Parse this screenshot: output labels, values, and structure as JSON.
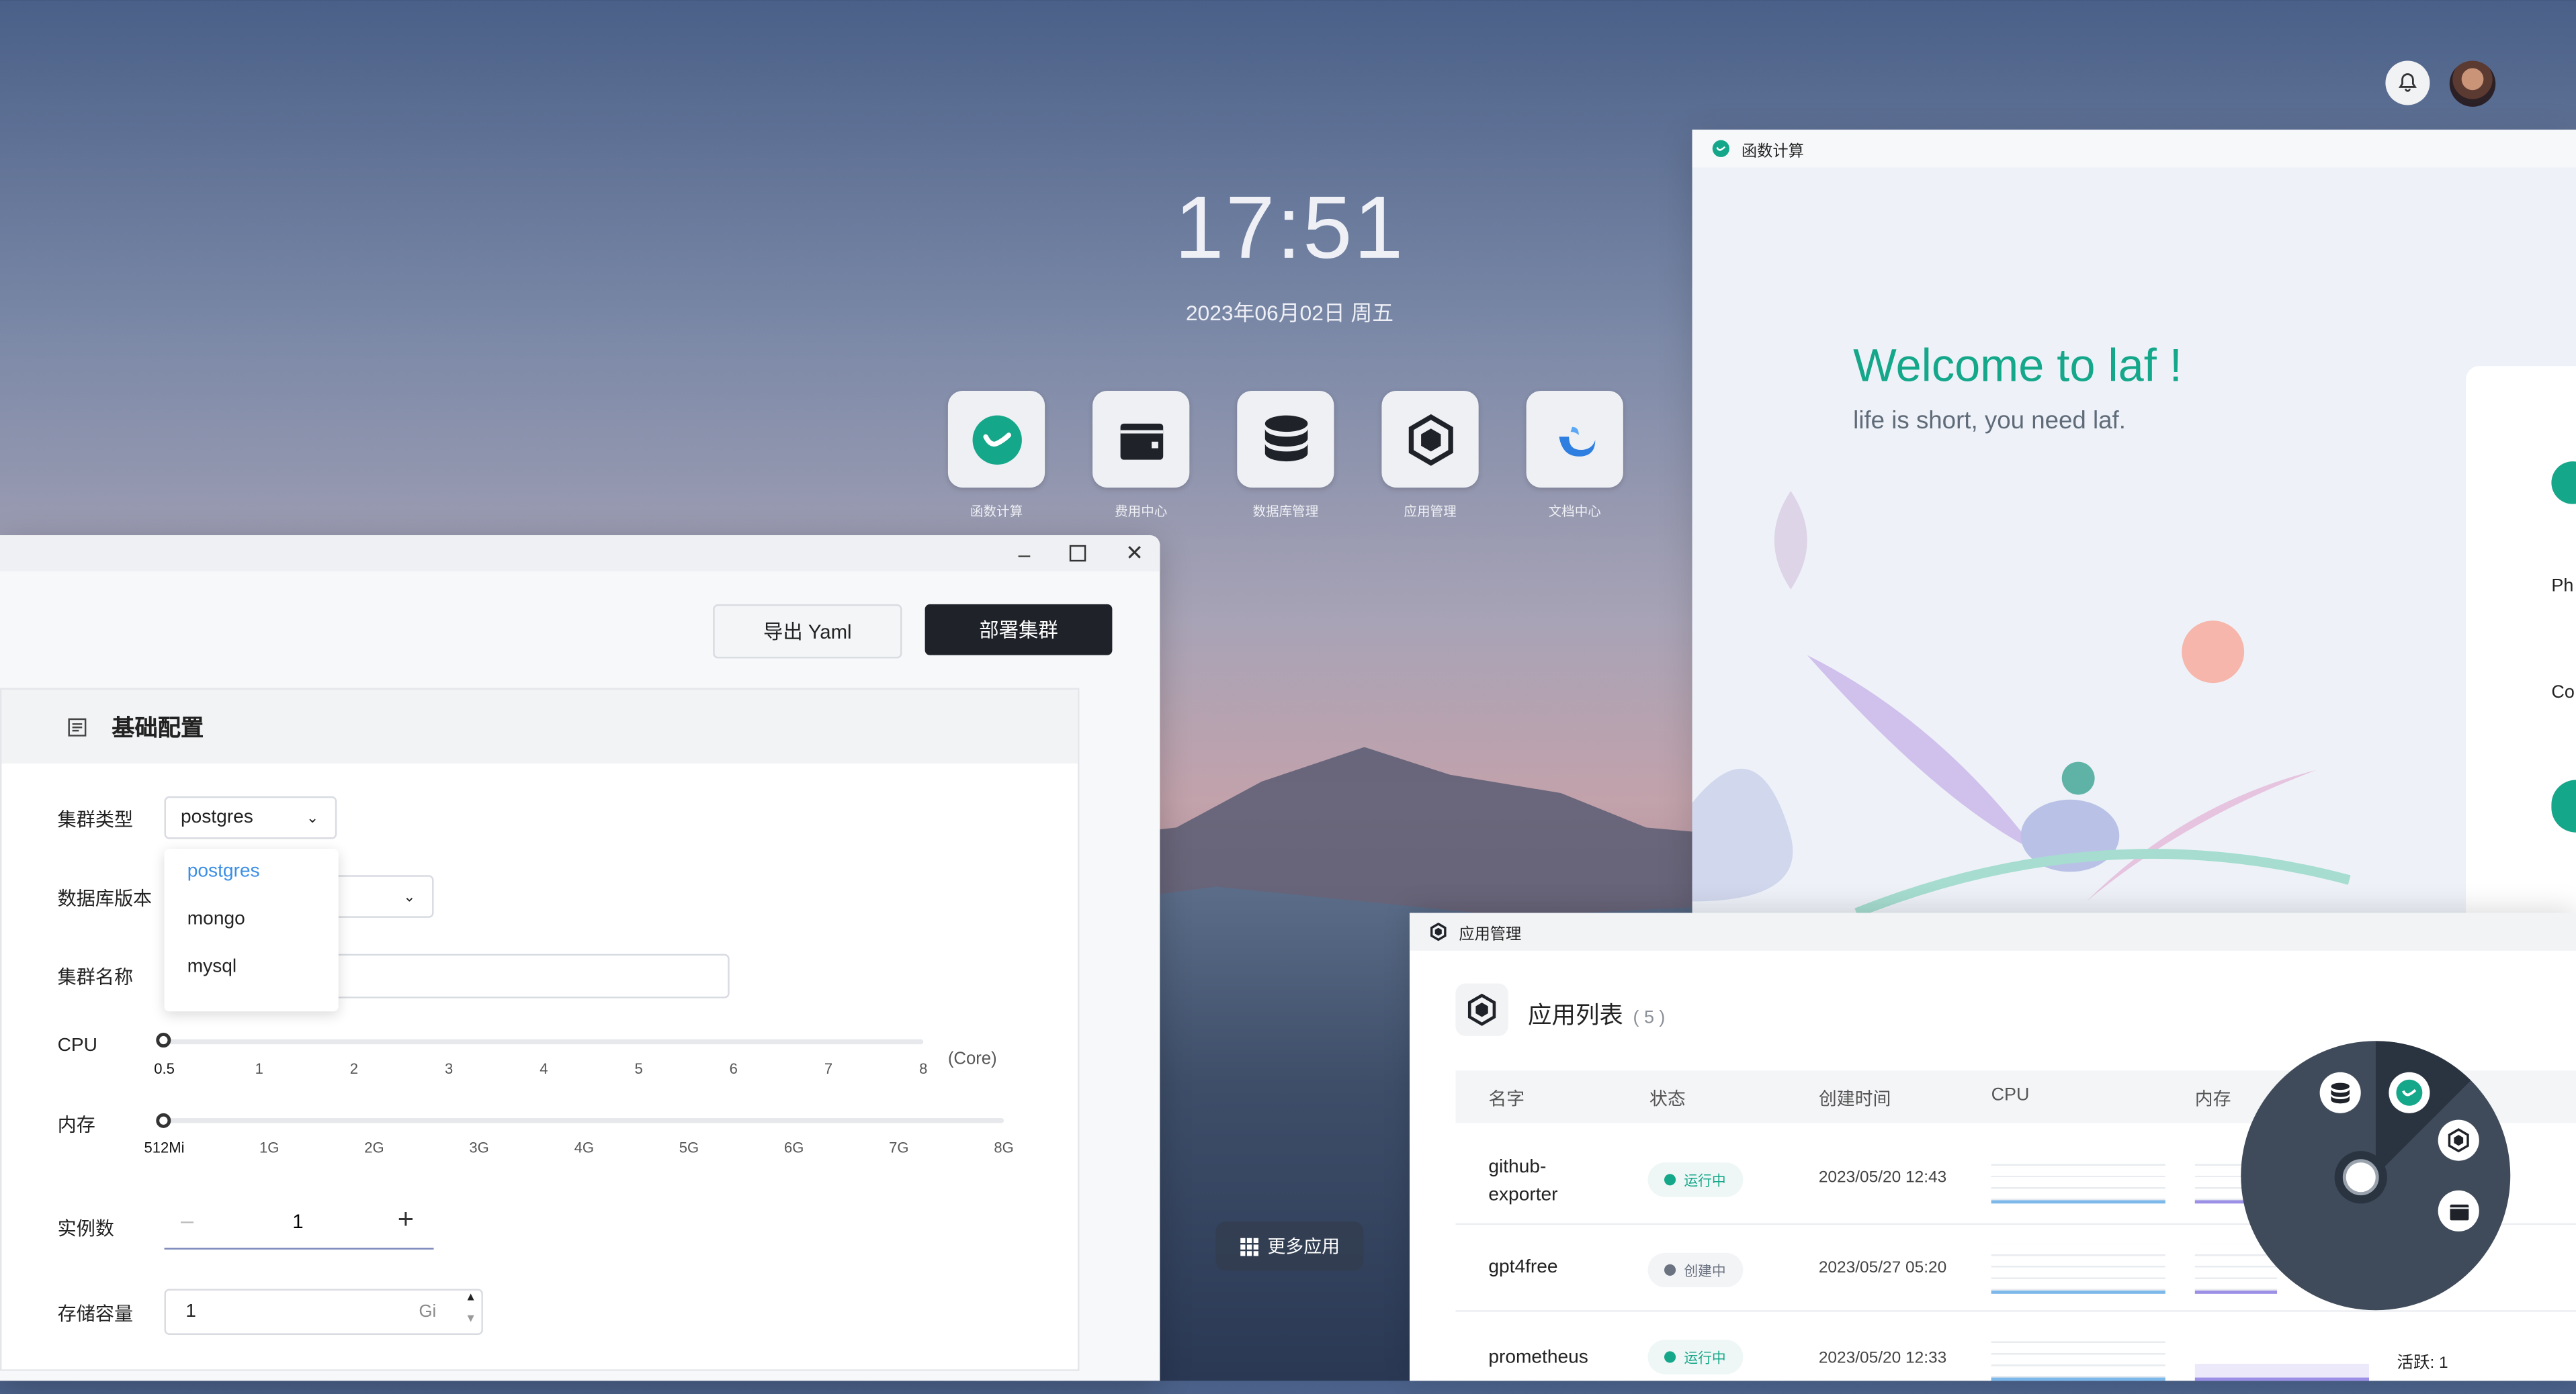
{
  "clock": {
    "time": "17:51",
    "date": "2023年06月02日 周五"
  },
  "dock": [
    {
      "label": "函数计算",
      "icon": "laf-icon"
    },
    {
      "label": "费用中心",
      "icon": "wallet-icon"
    },
    {
      "label": "数据库管理",
      "icon": "database-icon"
    },
    {
      "label": "应用管理",
      "icon": "app-hexagon-icon"
    },
    {
      "label": "文档中心",
      "icon": "docs-icon"
    }
  ],
  "db_window": {
    "export_label": "导出 Yaml",
    "deploy_label": "部署集群",
    "section_title": "基础配置",
    "fields": {
      "cluster_type_label": "集群类型",
      "cluster_type_value": "postgres",
      "db_version_label": "数据库版本",
      "cluster_name_label": "集群名称",
      "cpu_label": "CPU",
      "cpu_unit": "(Core)",
      "memory_label": "内存",
      "replicas_label": "实例数",
      "replicas_value": "1",
      "storage_label": "存储容量",
      "storage_value": "1",
      "storage_unit": "Gi"
    },
    "dropdown_options": [
      "postgres",
      "mongo",
      "mysql"
    ],
    "dropdown_selected": "postgres",
    "cpu_ticks": [
      "0.5",
      "1",
      "2",
      "3",
      "4",
      "5",
      "6",
      "7",
      "8"
    ],
    "cpu_value": "0.5",
    "memory_ticks": [
      "512Mi",
      "1G",
      "2G",
      "3G",
      "4G",
      "5G",
      "6G",
      "7G",
      "8G"
    ],
    "memory_value": "512Mi"
  },
  "laf_window": {
    "title": "函数计算",
    "welcome": "Welcome to laf !",
    "tagline": "life is short, you need laf.",
    "card_cut_1": "Ph",
    "card_cut_2": "Co"
  },
  "app_window": {
    "title": "应用管理",
    "list_title": "应用列表",
    "count": "( 5 )",
    "columns": [
      "名字",
      "状态",
      "创建时间",
      "CPU",
      "内存"
    ],
    "rows": [
      {
        "name_line1": "github-",
        "name_line2": "exporter",
        "status": "运行中",
        "created": "2023/05/20 12:43",
        "extra": ""
      },
      {
        "name_line1": "gpt4free",
        "name_line2": "",
        "status": "创建中",
        "created": "2023/05/27 05:20",
        "extra": ""
      },
      {
        "name_line1": "prometheus",
        "name_line2": "",
        "status": "运行中",
        "created": "2023/05/20 12:33",
        "extra": "活跃: 1"
      }
    ],
    "status_colors": {
      "running": "#15a78a",
      "creating": "#6b7280"
    }
  },
  "more_apps": "更多应用",
  "colors": {
    "accent": "#15a78a",
    "dark_button": "#1f2329"
  }
}
